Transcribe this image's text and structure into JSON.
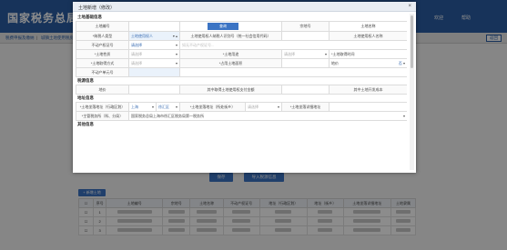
{
  "background": {
    "site_title": "国家税务总局上海",
    "user_text": "欢迎",
    "help_text": "帮助",
    "breadcrumb": [
      "税费申报及缴纳",
      "城镇土地使用税房产税..."
    ],
    "back_label": "返回",
    "save_label": "保存",
    "import_label": "导入税源信息",
    "add_label": "新增土地",
    "table_headers": [
      "序号",
      "土地编号",
      "宗地号",
      "土地名称",
      "不动产权证号",
      "地址（行政区划）",
      "地址（街乡）",
      "土地坐落详细地址",
      "土地隶属"
    ],
    "table_rows": [
      {
        "no": "1"
      },
      {
        "no": "2"
      },
      {
        "no": "3"
      }
    ]
  },
  "modal": {
    "title": "土地新增（修改）",
    "close_icon": "×",
    "sections": {
      "land_info": "土地基础信息",
      "tax_info": "税源信息",
      "address_info": "地址信息",
      "other_info": "其他信息"
    },
    "land": {
      "land_number_label": "土地编号",
      "land_number_button": "查询",
      "parcel_no_label": "宗地号",
      "land_name_label": "土地名称",
      "taxpayer_type_label": "*纳税人类型",
      "taxpayer_type_value": "土地使用权人",
      "owner_id_label": "土地使用权人纳税人识别号（统一社会信用代码）",
      "owner_name_label": "土地使用权人名称",
      "property_cert_label": "不动产权证号",
      "property_cert_value": "请选择",
      "property_cert_placeholder": "如无不动产权证号...",
      "land_nature_label": "*土地性质",
      "land_nature_value": "请选择",
      "land_use_label": "*土地用途",
      "land_use_value": "请选择",
      "land_use_right_value": "请选择",
      "acquire_time_label": "*土地取得时间",
      "acquire_method_label": "*土地取得方式",
      "acquire_method_value": "请选择",
      "area_label": "*占用土地面积",
      "price_label": "地价",
      "price_value": "否",
      "unit_label": "不动产单元号"
    },
    "tax": {
      "land_price_label": "地价",
      "paid_label": "其中取得土地使用权支付金额",
      "dev_cost_label": "其中土地开发成本"
    },
    "address": {
      "district_label": "*土地坐落地址（行政区划）",
      "district_value": "上海",
      "district_value2": "徐汇区",
      "street_label": "*土地坐落地址（所处街乡）",
      "street_value": "请选择",
      "detail_label": "*土地坐落详细地址",
      "tax_authority_label": "*主管税务所（科、分局）",
      "tax_authority_value": "国家税务总局上海市徐汇区税务局第一税务所"
    }
  }
}
